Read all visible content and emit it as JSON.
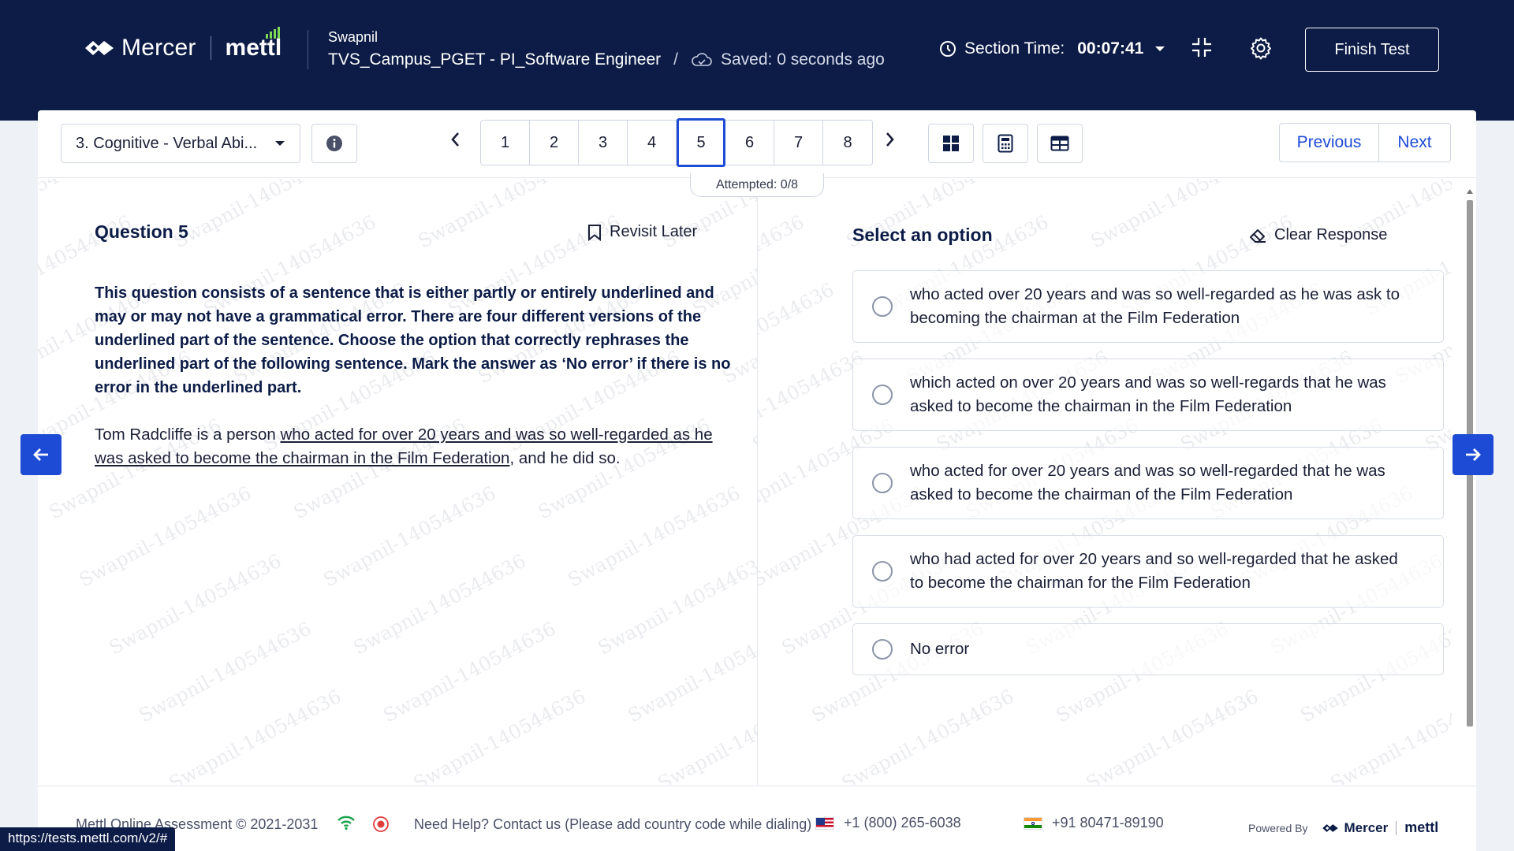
{
  "header": {
    "brand_mercer": "Mercer",
    "brand_mettl": "mettl",
    "user_name": "Swapnil",
    "test_name": "TVS_Campus_PGET - PI_Software Engineer",
    "separator": "/",
    "saved_status": "Saved: 0 seconds ago",
    "section_time_label": "Section Time:",
    "section_time_value": "00:07:41",
    "finish_label": "Finish Test"
  },
  "toolbar": {
    "section_selected": "3. Cognitive - Verbal Abi...",
    "question_numbers": [
      "1",
      "2",
      "3",
      "4",
      "5",
      "6",
      "7",
      "8"
    ],
    "active_question": "5",
    "attempted": "Attempted: 0/8",
    "previous_label": "Previous",
    "next_label": "Next"
  },
  "question": {
    "title": "Question 5",
    "revisit_label": "Revisit Later",
    "instruction": "This question consists of a sentence that is either partly or entirely underlined and may or may not have a grammatical error. There are four different versions of the underlined part of the sentence. Choose the option that correctly rephrases the underlined part of the following sentence. Mark the answer as ‘No error’ if there is no error in the underlined part.",
    "sentence_pre": "Tom Radcliffe is a person ",
    "sentence_underlined": "who acted for over 20 years and was so well-regarded as he was asked to become the chairman in the Film Federation",
    "sentence_post": ", and he did so."
  },
  "options": {
    "title": "Select an option",
    "clear_label": "Clear Response",
    "items": [
      "who acted over 20 years and was so well-regarded as he was ask to becoming the chairman at the Film Federation",
      "which acted on over 20 years and was so well-regards that he was asked to become the chairman in the Film Federation",
      "who acted for over 20 years and was so well-regarded that he was asked to become the chairman of the Film Federation",
      "who had acted for over 20 years and so well-regarded that he asked to become the chairman for the Film Federation",
      "No error"
    ]
  },
  "watermark_text": "Swapnil-140544636",
  "footer": {
    "copyright": "Mettl Online Assessment © 2021-2031",
    "help": "Need Help? Contact us (Please add country code while dialing)",
    "phone_us": "+1 (800) 265-6038",
    "phone_in": "+91 80471-89190",
    "powered_by": "Powered By",
    "powered_mercer": "Mercer",
    "powered_mettl": "mettl"
  },
  "status_url": "https://tests.mettl.com/v2/#",
  "colors": {
    "header_bg": "#0c1c47",
    "accent": "#1d4bd6",
    "mettl_green": "#7ed957"
  }
}
